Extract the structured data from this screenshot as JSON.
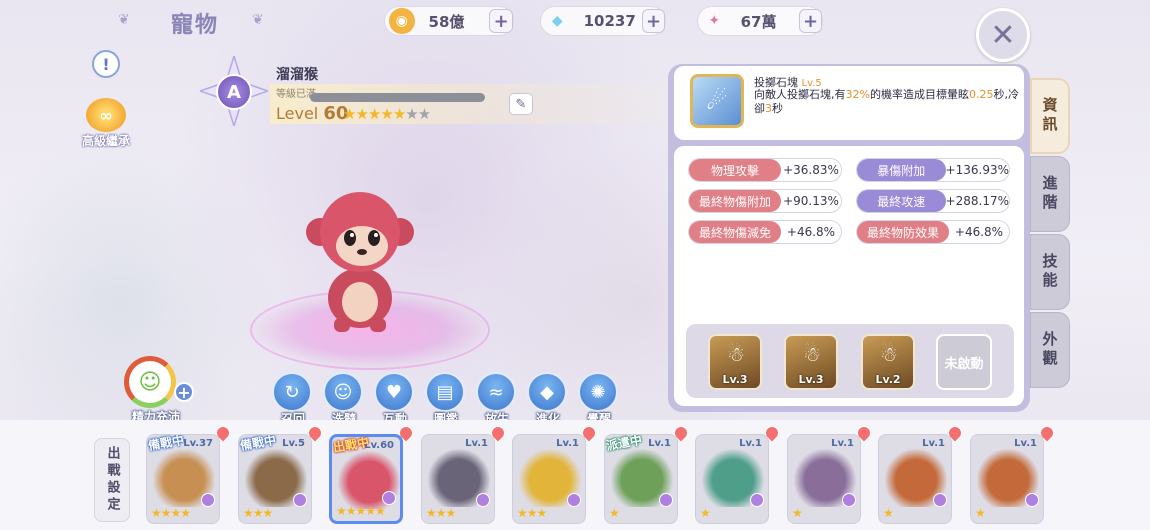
{
  "header": {
    "title": "寵物",
    "currencies": [
      {
        "icon": "gold-coin-icon",
        "value": "58億"
      },
      {
        "icon": "diamond-icon",
        "value": "10237"
      },
      {
        "icon": "crystal-icon",
        "value": "67萬"
      }
    ],
    "add_label": "+",
    "close_label": "✕"
  },
  "left": {
    "info_label": "!",
    "inherit_label": "高級繼承",
    "energy_label": "精力充沛"
  },
  "pet": {
    "grade": "A",
    "name": "溜溜猴",
    "max_level_text": "等級已滿",
    "level_prefix": "Level",
    "level": "60",
    "stars_filled": 5,
    "stars_total": 7
  },
  "actions": [
    {
      "label": "召回",
      "icon": "recall-icon",
      "glyph": "↻"
    },
    {
      "label": "洗髓",
      "icon": "wash-icon",
      "glyph": "☺"
    },
    {
      "label": "互動",
      "icon": "heart-icon",
      "glyph": "♥"
    },
    {
      "label": "圖鑑",
      "icon": "book-icon",
      "glyph": "▤"
    },
    {
      "label": "放生",
      "icon": "release-icon",
      "glyph": "≈"
    },
    {
      "label": "進化",
      "icon": "evolve-icon",
      "glyph": "◆"
    },
    {
      "label": "覺醒",
      "icon": "awaken-icon",
      "glyph": "✺"
    }
  ],
  "skill": {
    "name": "投擲石塊",
    "level": "Lv.5",
    "desc_1": "向敵人投擲石塊,有",
    "desc_pct": "32%",
    "desc_2": "的機率造成目標暈眩",
    "desc_sec": "0.25",
    "desc_3": "秒,冷卻",
    "desc_cd": "3",
    "desc_4": "秒"
  },
  "stats": [
    {
      "name": "物理攻擊",
      "value": "+36.83%",
      "color": "red"
    },
    {
      "name": "暴傷附加",
      "value": "+136.93%",
      "color": "purple"
    },
    {
      "name": "最終物傷附加",
      "value": "+90.13%",
      "color": "red"
    },
    {
      "name": "最終攻速",
      "value": "+288.17%",
      "color": "purple"
    },
    {
      "name": "最終物傷減免",
      "value": "+46.8%",
      "color": "red"
    },
    {
      "name": "最終物防效果",
      "value": "+46.8%",
      "color": "red"
    }
  ],
  "mini_skills": [
    {
      "level": "Lv.3"
    },
    {
      "level": "Lv.3"
    },
    {
      "level": "Lv.2"
    }
  ],
  "locked_skill_label": "未啟動",
  "tabs": [
    {
      "label": "資訊",
      "active": true
    },
    {
      "label": "進階",
      "active": false
    },
    {
      "label": "技能",
      "active": false
    },
    {
      "label": "外觀",
      "active": false
    }
  ],
  "deploy_label": "出戰設定",
  "roster": [
    {
      "level": "Lv.37",
      "stars": 4,
      "tag": "備戰中",
      "tag_color": "blue",
      "color": "#c79052"
    },
    {
      "level": "Lv.5",
      "stars": 3,
      "tag": "備戰中",
      "tag_color": "blue",
      "color": "#8a6a48"
    },
    {
      "level": "Lv.60",
      "stars": 5,
      "tag": "出戰中",
      "tag_color": "red",
      "color": "#d9556a",
      "selected": true
    },
    {
      "level": "Lv.1",
      "stars": 3,
      "tag": "",
      "tag_color": "",
      "color": "#6a6478"
    },
    {
      "level": "Lv.1",
      "stars": 3,
      "tag": "",
      "tag_color": "",
      "color": "#e2b43a"
    },
    {
      "level": "Lv.1",
      "stars": 1,
      "tag": "派遣中",
      "tag_color": "green",
      "color": "#6ea05a"
    },
    {
      "level": "Lv.1",
      "stars": 1,
      "tag": "",
      "tag_color": "",
      "color": "#4e9e8a"
    },
    {
      "level": "Lv.1",
      "stars": 1,
      "tag": "",
      "tag_color": "",
      "color": "#8a6e9a"
    },
    {
      "level": "Lv.1",
      "stars": 1,
      "tag": "",
      "tag_color": "",
      "color": "#c46a3a"
    },
    {
      "level": "Lv.1",
      "stars": 1,
      "tag": "",
      "tag_color": "",
      "color": "#c46a3a"
    }
  ]
}
